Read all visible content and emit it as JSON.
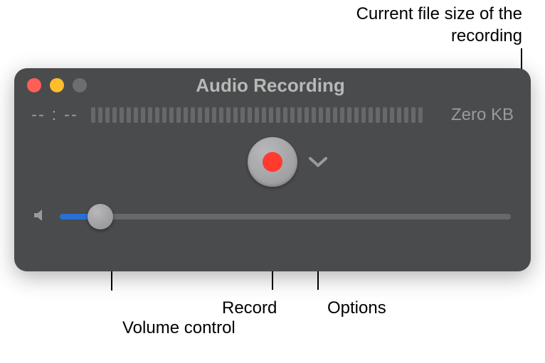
{
  "callouts": {
    "filesize": "Current file size of the recording",
    "volume": "Volume control",
    "record": "Record",
    "options": "Options"
  },
  "window": {
    "title": "Audio Recording",
    "time": "-- : --",
    "file_size": "Zero KB",
    "level_bars": 47,
    "volume_percent": 9
  },
  "icons": {
    "close": "close-icon",
    "minimize": "minimize-icon",
    "fullscreen": "fullscreen-icon",
    "record": "record-icon",
    "chevron": "chevron-down-icon",
    "speaker": "speaker-icon"
  },
  "colors": {
    "window_bg": "#4a4b4c",
    "accent": "#2a6fd6",
    "record_red": "#ff3b30",
    "text_muted": "#9a9a9a"
  }
}
